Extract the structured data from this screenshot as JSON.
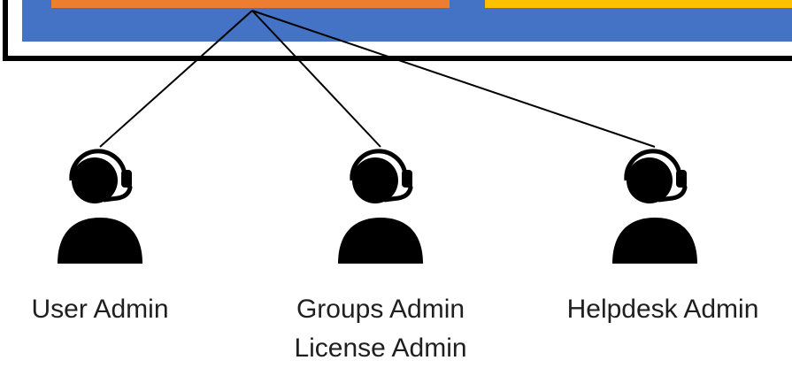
{
  "colors": {
    "frame_border": "#000000",
    "container_fill": "#4472c4",
    "left_block": "#ed7d31",
    "right_block": "#ffc000",
    "connector": "#000000",
    "icon": "#000000",
    "label_text": "#1f1f1f"
  },
  "icon_name": "support-agent-headset-icon",
  "admins": [
    {
      "label": "User Admin"
    },
    {
      "label": "Groups Admin",
      "label2": "License Admin"
    },
    {
      "label": "Helpdesk Admin"
    }
  ]
}
